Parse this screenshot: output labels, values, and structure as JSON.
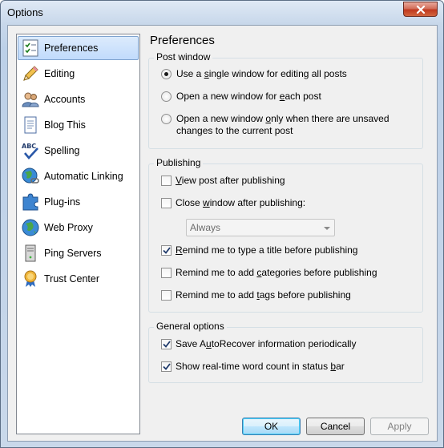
{
  "window": {
    "title": "Options"
  },
  "sidebar": {
    "items": [
      {
        "label": "Preferences",
        "icon": "preferences-checklist-icon",
        "selected": true
      },
      {
        "label": "Editing",
        "icon": "pencil-icon"
      },
      {
        "label": "Accounts",
        "icon": "users-icon"
      },
      {
        "label": "Blog This",
        "icon": "document-icon"
      },
      {
        "label": "Spelling",
        "icon": "abc-check-icon"
      },
      {
        "label": "Automatic Linking",
        "icon": "globe-link-icon"
      },
      {
        "label": "Plug-ins",
        "icon": "puzzle-icon"
      },
      {
        "label": "Web Proxy",
        "icon": "globe-icon"
      },
      {
        "label": "Ping Servers",
        "icon": "server-tower-icon"
      },
      {
        "label": "Trust Center",
        "icon": "ribbon-award-icon"
      }
    ]
  },
  "panel": {
    "title": "Preferences",
    "post_window": {
      "label": "Post window",
      "options": [
        {
          "pre": "Use a ",
          "key": "s",
          "post": "ingle window for editing all posts",
          "checked": true
        },
        {
          "pre": "Open a new window for ",
          "key": "e",
          "post": "ach post",
          "checked": false
        },
        {
          "pre": "Open a new window ",
          "key": "o",
          "post": "nly when there are unsaved",
          "line2": "changes to the current post",
          "checked": false
        }
      ]
    },
    "publishing": {
      "label": "Publishing",
      "view_post": {
        "pre": "",
        "key": "V",
        "post": "iew post after publishing",
        "checked": false
      },
      "close_window": {
        "pre": "Close ",
        "key": "w",
        "post": "indow after publishing:",
        "checked": false
      },
      "close_select": {
        "value": "Always",
        "options": [
          "Always"
        ]
      },
      "remind_title": {
        "pre": "",
        "key": "R",
        "post": "emind me to type a title before publishing",
        "checked": true
      },
      "remind_categories": {
        "pre": "Remind me to add ",
        "key": "c",
        "post": "ategories before publishing",
        "checked": false
      },
      "remind_tags": {
        "pre": "Remind me to add ",
        "key": "t",
        "post": "ags before publishing",
        "checked": false
      }
    },
    "general": {
      "label": "General options",
      "autorecover": {
        "pre": "Save A",
        "key": "u",
        "post": "toRecover information periodically",
        "checked": true
      },
      "word_count": {
        "pre": "Show real-time word count in status ",
        "key": "b",
        "post": "ar",
        "checked": true
      }
    }
  },
  "buttons": {
    "ok": "OK",
    "cancel": "Cancel",
    "apply": "Apply"
  },
  "colors": {
    "accent_select": "#c1dbfc",
    "close_button": "#c0391f"
  }
}
